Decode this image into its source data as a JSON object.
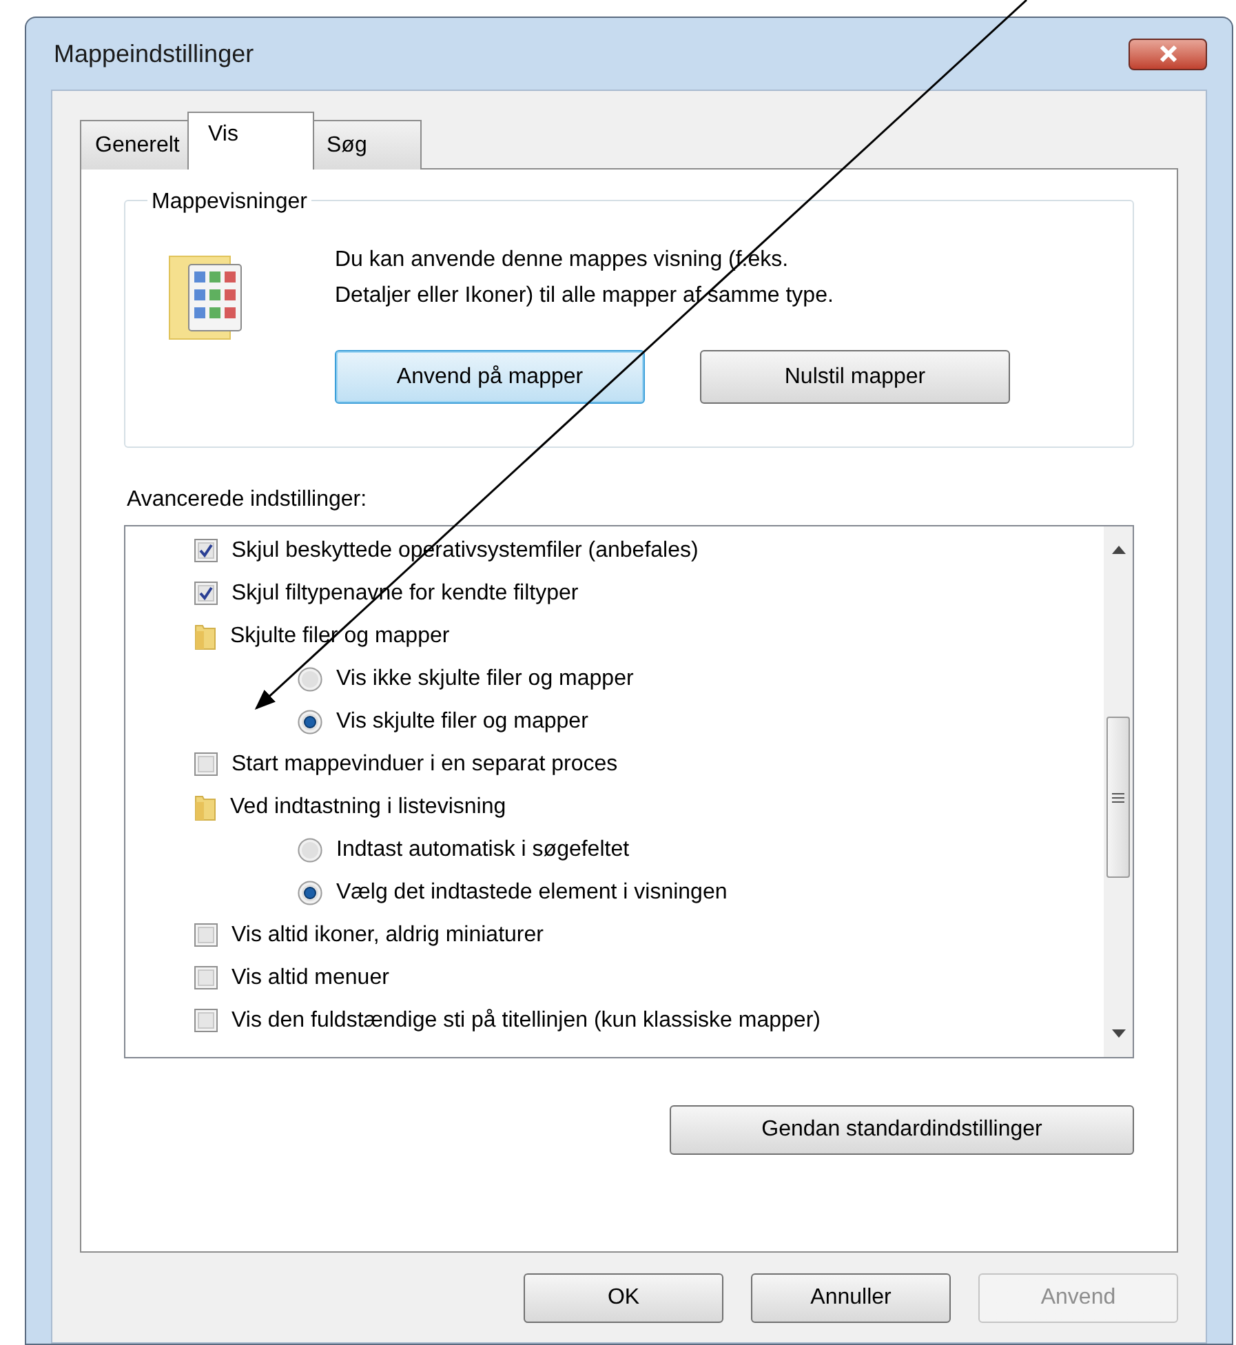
{
  "window": {
    "title": "Mappeindstillinger"
  },
  "tabs": [
    {
      "label": "Generelt",
      "selected": false
    },
    {
      "label": "Vis",
      "selected": true
    },
    {
      "label": "Søg",
      "selected": false
    }
  ],
  "folder_views": {
    "legend": "Mappevisninger",
    "description_lines": [
      "Du kan anvende denne mappes visning (f.eks.",
      "Detaljer eller Ikoner) til alle mapper af samme type."
    ],
    "buttons": [
      {
        "label": "Anvend på mapper",
        "focused": true
      },
      {
        "label": "Nulstil mapper",
        "focused": false
      }
    ]
  },
  "advanced": {
    "label": "Avancerede indstillinger:",
    "items": [
      {
        "kind": "checkbox",
        "label": "Skjul beskyttede operativsystemfiler (anbefales)",
        "checked": true
      },
      {
        "kind": "checkbox",
        "label": "Skjul filtypenavne for kendte filtyper",
        "checked": true
      },
      {
        "kind": "folder",
        "label": "Skjulte filer og mapper",
        "children": [
          {
            "kind": "radio",
            "label": "Vis ikke skjulte filer og mapper",
            "checked": false
          },
          {
            "kind": "radio",
            "label": "Vis skjulte filer og mapper",
            "checked": true
          }
        ]
      },
      {
        "kind": "checkbox",
        "label": "Start mappevinduer i en separat proces",
        "checked": false
      },
      {
        "kind": "folder",
        "label": "Ved indtastning i listevisning",
        "children": [
          {
            "kind": "radio",
            "label": "Indtast automatisk i søgefeltet",
            "checked": false
          },
          {
            "kind": "radio",
            "label": "Vælg det indtastede element i visningen",
            "checked": true
          }
        ]
      },
      {
        "kind": "checkbox",
        "label": "Vis altid ikoner, aldrig miniaturer",
        "checked": false
      },
      {
        "kind": "checkbox",
        "label": "Vis altid menuer",
        "checked": false
      },
      {
        "kind": "checkbox",
        "label": "Vis den fuldstændige sti på titellinjen (kun klassiske mapper)",
        "checked": false
      }
    ],
    "restore_button": "Gendan standardindstillinger"
  },
  "buttons": [
    {
      "label": "OK",
      "disabled": false
    },
    {
      "label": "Annuller",
      "disabled": false
    },
    {
      "label": "Anvend",
      "disabled": true
    }
  ]
}
